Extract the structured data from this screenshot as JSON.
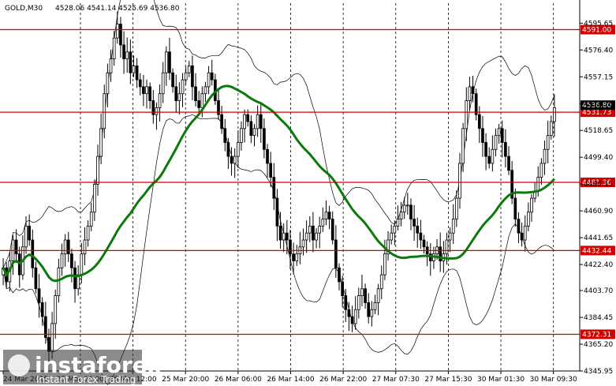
{
  "header": {
    "symbol": "GOLD,M30",
    "ohlc": "4528.06 4541.14 4525.69 4536.80"
  },
  "watermark": {
    "brand": "instaforex",
    "tagline": "Instant Forex Trading"
  },
  "colors": {
    "candle": "#000000",
    "ma": "#0b7a0b",
    "bands": "#000000",
    "level_line": "#d40000",
    "level_label_bg": "#d40000",
    "price_label_bg": "#000000"
  },
  "chart_data": {
    "type": "candlestick",
    "ylim": [
      4345.95,
      4610
    ],
    "y_ticks": [
      "4595.65",
      "4576.40",
      "4557.15",
      "4537.75",
      "4518.65",
      "4499.40",
      "4480.15",
      "4460.90",
      "4441.65",
      "4422.40",
      "4403.70",
      "4384.45",
      "4365.20",
      "4345.95"
    ],
    "x_ticks": [
      "24 Mar 2025",
      "25 Mar 04:00",
      "25 Mar 12:00",
      "25 Mar 20:00",
      "26 Mar 06:00",
      "26 Mar 14:00",
      "26 Mar 22:00",
      "27 Mar 07:30",
      "27 Mar 15:30",
      "30 Mar 01:30",
      "30 Mar 09:30"
    ],
    "x_start_label": "24 Mar 2025",
    "levels": [
      {
        "value": 4591.0,
        "label": "4591.00"
      },
      {
        "value": 4531.73,
        "label": "4531.73"
      },
      {
        "value": 4481.36,
        "label": "4481.36"
      },
      {
        "value": 4432.44,
        "label": "4432.44"
      },
      {
        "value": 4372.31,
        "label": "4372.31"
      }
    ],
    "current_price": {
      "value": 4536.8,
      "label": "4536.80"
    },
    "closes": [
      4420,
      4410,
      4425,
      4440,
      4430,
      4415,
      4435,
      4450,
      4440,
      4420,
      4405,
      4395,
      4385,
      4370,
      4360,
      4380,
      4400,
      4420,
      4430,
      4440,
      4430,
      4420,
      4405,
      4415,
      4430,
      4440,
      4450,
      4460,
      4480,
      4500,
      4520,
      4545,
      4560,
      4570,
      4585,
      4595,
      4580,
      4570,
      4575,
      4560,
      4565,
      4555,
      4550,
      4545,
      4550,
      4540,
      4530,
      4535,
      4545,
      4560,
      4575,
      4560,
      4550,
      4540,
      4545,
      4555,
      4560,
      4565,
      4550,
      4540,
      4535,
      4545,
      4550,
      4560,
      4555,
      4540,
      4530,
      4520,
      4510,
      4500,
      4495,
      4500,
      4510,
      4520,
      4530,
      4525,
      4515,
      4520,
      4530,
      4520,
      4505,
      4495,
      4485,
      4470,
      4450,
      4440,
      4445,
      4440,
      4430,
      4425,
      4430,
      4435,
      4440,
      4445,
      4450,
      4440,
      4445,
      4450,
      4455,
      4460,
      4455,
      4440,
      4420,
      4410,
      4400,
      4390,
      4385,
      4380,
      4390,
      4400,
      4405,
      4395,
      4385,
      4390,
      4395,
      4405,
      4415,
      4430,
      4440,
      4445,
      4450,
      4455,
      4460,
      4465,
      4465,
      4455,
      4450,
      4445,
      4440,
      4435,
      4430,
      4425,
      4430,
      4435,
      4425,
      4430,
      4440,
      4445,
      4455,
      4470,
      4495,
      4520,
      4540,
      4550,
      4545,
      4530,
      4520,
      4510,
      4500,
      4495,
      4505,
      4515,
      4520,
      4510,
      4500,
      4490,
      4470,
      4455,
      4445,
      4440,
      4450,
      4460,
      4470,
      4475,
      4485,
      4495,
      4505,
      4515,
      4525,
      4535
    ]
  }
}
